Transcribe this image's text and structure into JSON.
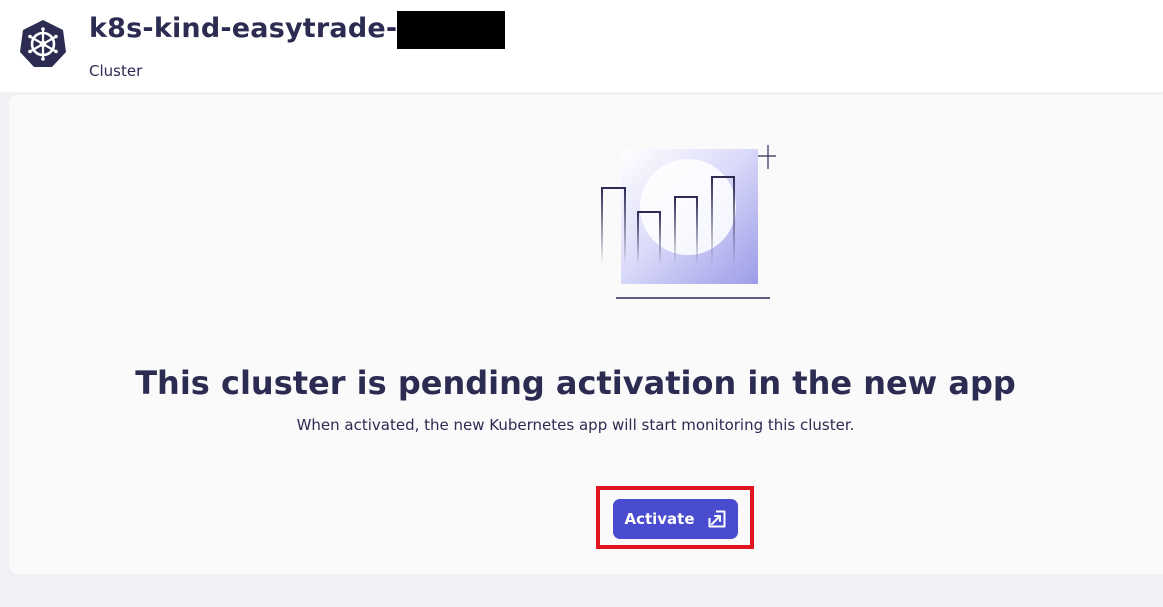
{
  "header": {
    "title": "k8s-kind-easytrade-",
    "subtitle": "Cluster",
    "logo_icon": "kubernetes-helm-icon",
    "logo_color": "#2c2b52"
  },
  "main": {
    "illustration_icon": "bar-chart-illustration",
    "heading": "This cluster is pending activation in the new app",
    "description": "When activated, the new Kubernetes app will start monitoring this cluster.",
    "activate_button": {
      "label": "Activate",
      "icon": "open-in-new-icon",
      "color": "#4a4ccf"
    },
    "highlight_color": "#e0141e"
  }
}
